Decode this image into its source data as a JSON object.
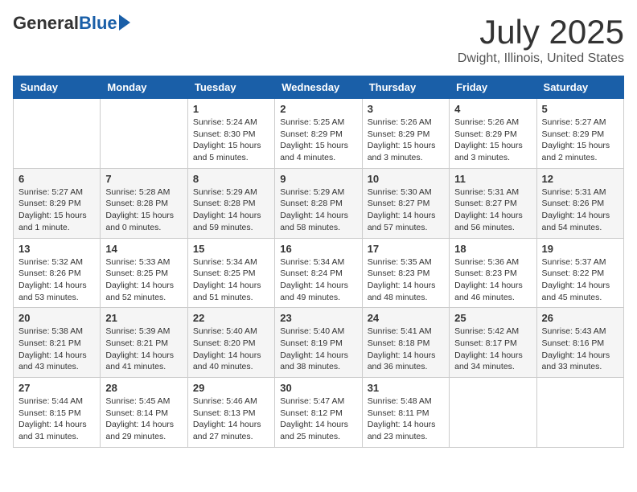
{
  "logo": {
    "general": "General",
    "blue": "Blue"
  },
  "title": "July 2025",
  "location": "Dwight, Illinois, United States",
  "days_of_week": [
    "Sunday",
    "Monday",
    "Tuesday",
    "Wednesday",
    "Thursday",
    "Friday",
    "Saturday"
  ],
  "weeks": [
    [
      {
        "day": "",
        "info": ""
      },
      {
        "day": "",
        "info": ""
      },
      {
        "day": "1",
        "info": "Sunrise: 5:24 AM\nSunset: 8:30 PM\nDaylight: 15 hours\nand 5 minutes."
      },
      {
        "day": "2",
        "info": "Sunrise: 5:25 AM\nSunset: 8:29 PM\nDaylight: 15 hours\nand 4 minutes."
      },
      {
        "day": "3",
        "info": "Sunrise: 5:26 AM\nSunset: 8:29 PM\nDaylight: 15 hours\nand 3 minutes."
      },
      {
        "day": "4",
        "info": "Sunrise: 5:26 AM\nSunset: 8:29 PM\nDaylight: 15 hours\nand 3 minutes."
      },
      {
        "day": "5",
        "info": "Sunrise: 5:27 AM\nSunset: 8:29 PM\nDaylight: 15 hours\nand 2 minutes."
      }
    ],
    [
      {
        "day": "6",
        "info": "Sunrise: 5:27 AM\nSunset: 8:29 PM\nDaylight: 15 hours\nand 1 minute."
      },
      {
        "day": "7",
        "info": "Sunrise: 5:28 AM\nSunset: 8:28 PM\nDaylight: 15 hours\nand 0 minutes."
      },
      {
        "day": "8",
        "info": "Sunrise: 5:29 AM\nSunset: 8:28 PM\nDaylight: 14 hours\nand 59 minutes."
      },
      {
        "day": "9",
        "info": "Sunrise: 5:29 AM\nSunset: 8:28 PM\nDaylight: 14 hours\nand 58 minutes."
      },
      {
        "day": "10",
        "info": "Sunrise: 5:30 AM\nSunset: 8:27 PM\nDaylight: 14 hours\nand 57 minutes."
      },
      {
        "day": "11",
        "info": "Sunrise: 5:31 AM\nSunset: 8:27 PM\nDaylight: 14 hours\nand 56 minutes."
      },
      {
        "day": "12",
        "info": "Sunrise: 5:31 AM\nSunset: 8:26 PM\nDaylight: 14 hours\nand 54 minutes."
      }
    ],
    [
      {
        "day": "13",
        "info": "Sunrise: 5:32 AM\nSunset: 8:26 PM\nDaylight: 14 hours\nand 53 minutes."
      },
      {
        "day": "14",
        "info": "Sunrise: 5:33 AM\nSunset: 8:25 PM\nDaylight: 14 hours\nand 52 minutes."
      },
      {
        "day": "15",
        "info": "Sunrise: 5:34 AM\nSunset: 8:25 PM\nDaylight: 14 hours\nand 51 minutes."
      },
      {
        "day": "16",
        "info": "Sunrise: 5:34 AM\nSunset: 8:24 PM\nDaylight: 14 hours\nand 49 minutes."
      },
      {
        "day": "17",
        "info": "Sunrise: 5:35 AM\nSunset: 8:23 PM\nDaylight: 14 hours\nand 48 minutes."
      },
      {
        "day": "18",
        "info": "Sunrise: 5:36 AM\nSunset: 8:23 PM\nDaylight: 14 hours\nand 46 minutes."
      },
      {
        "day": "19",
        "info": "Sunrise: 5:37 AM\nSunset: 8:22 PM\nDaylight: 14 hours\nand 45 minutes."
      }
    ],
    [
      {
        "day": "20",
        "info": "Sunrise: 5:38 AM\nSunset: 8:21 PM\nDaylight: 14 hours\nand 43 minutes."
      },
      {
        "day": "21",
        "info": "Sunrise: 5:39 AM\nSunset: 8:21 PM\nDaylight: 14 hours\nand 41 minutes."
      },
      {
        "day": "22",
        "info": "Sunrise: 5:40 AM\nSunset: 8:20 PM\nDaylight: 14 hours\nand 40 minutes."
      },
      {
        "day": "23",
        "info": "Sunrise: 5:40 AM\nSunset: 8:19 PM\nDaylight: 14 hours\nand 38 minutes."
      },
      {
        "day": "24",
        "info": "Sunrise: 5:41 AM\nSunset: 8:18 PM\nDaylight: 14 hours\nand 36 minutes."
      },
      {
        "day": "25",
        "info": "Sunrise: 5:42 AM\nSunset: 8:17 PM\nDaylight: 14 hours\nand 34 minutes."
      },
      {
        "day": "26",
        "info": "Sunrise: 5:43 AM\nSunset: 8:16 PM\nDaylight: 14 hours\nand 33 minutes."
      }
    ],
    [
      {
        "day": "27",
        "info": "Sunrise: 5:44 AM\nSunset: 8:15 PM\nDaylight: 14 hours\nand 31 minutes."
      },
      {
        "day": "28",
        "info": "Sunrise: 5:45 AM\nSunset: 8:14 PM\nDaylight: 14 hours\nand 29 minutes."
      },
      {
        "day": "29",
        "info": "Sunrise: 5:46 AM\nSunset: 8:13 PM\nDaylight: 14 hours\nand 27 minutes."
      },
      {
        "day": "30",
        "info": "Sunrise: 5:47 AM\nSunset: 8:12 PM\nDaylight: 14 hours\nand 25 minutes."
      },
      {
        "day": "31",
        "info": "Sunrise: 5:48 AM\nSunset: 8:11 PM\nDaylight: 14 hours\nand 23 minutes."
      },
      {
        "day": "",
        "info": ""
      },
      {
        "day": "",
        "info": ""
      }
    ]
  ]
}
